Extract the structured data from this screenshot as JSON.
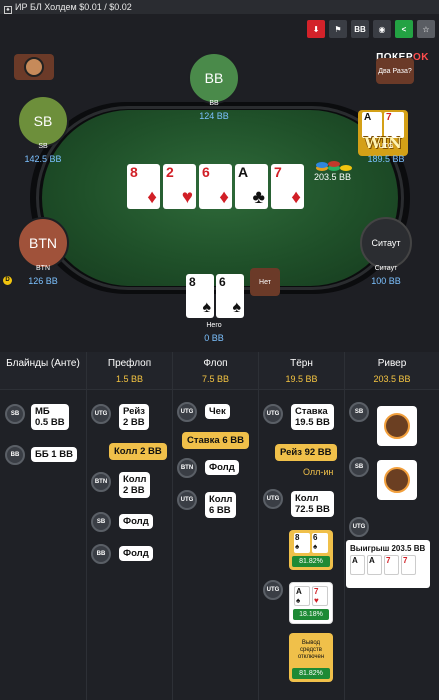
{
  "window": {
    "title": "ИР БЛ Холдем $0.01 / $0.02"
  },
  "toolbar": {
    "buttons": [
      {
        "icon": "download-icon",
        "glyph": "⬇",
        "style": "red"
      },
      {
        "icon": "flag-icon",
        "glyph": "⚑",
        "style": "dark"
      },
      {
        "icon": "bb-toggle-icon",
        "glyph": "BB",
        "style": "dark"
      },
      {
        "icon": "spy-icon",
        "glyph": "◉",
        "style": "dark"
      },
      {
        "icon": "share-icon",
        "glyph": "<",
        "style": "green"
      },
      {
        "icon": "star-icon",
        "glyph": "☆",
        "style": "grey"
      }
    ]
  },
  "brand": {
    "prefix": "ПОКЕР",
    "accent": "OK"
  },
  "table": {
    "board": [
      {
        "rank": "8",
        "suit": "♦",
        "color": "red"
      },
      {
        "rank": "2",
        "suit": "♥",
        "color": "red"
      },
      {
        "rank": "6",
        "suit": "♦",
        "color": "red"
      },
      {
        "rank": "A",
        "suit": "♣",
        "color": "black"
      },
      {
        "rank": "7",
        "suit": "♦",
        "color": "red"
      }
    ],
    "pot": "203.5 BB",
    "seats": {
      "bb": {
        "label": "BB",
        "name": "BB",
        "stack": "124 BB",
        "color": "#4a8a4a"
      },
      "sb": {
        "label": "SB",
        "name": "SB",
        "stack": "142.5 BB",
        "color": "#6d8f3b"
      },
      "utg": {
        "name": "UTG",
        "stack": "189.5 BB"
      },
      "btn": {
        "label": "BTN",
        "name": "BTN",
        "stack": "126 BB",
        "color": "#a0523a"
      },
      "sitout": {
        "label": "Ситаут",
        "name": "Ситаут",
        "stack": "100 BB",
        "color": "#2b2d31"
      },
      "hero": {
        "name": "Него",
        "stack": "0 BB",
        "cards": [
          {
            "rank": "8",
            "suit": "♠"
          },
          {
            "rank": "6",
            "suit": "♠"
          }
        ]
      }
    },
    "bubbles": {
      "utg": "Два Раза?",
      "hero": "Нет"
    },
    "winner_badge": {
      "text": "WIN",
      "cards": [
        {
          "rank": "A",
          "color": "black"
        },
        {
          "rank": "7",
          "color": "red"
        }
      ]
    },
    "dealer": "D"
  },
  "history": {
    "columns": [
      {
        "title": "Блайнды (Анте)",
        "pot": ""
      },
      {
        "title": "Префлоп",
        "pot": "1.5 BB"
      },
      {
        "title": "Флоп",
        "pot": "7.5 BB"
      },
      {
        "title": "Тёрн",
        "pot": "19.5 BB"
      },
      {
        "title": "Ривер",
        "pot": "203.5 BB"
      }
    ],
    "blinds": [
      {
        "pos": "SB",
        "text": "МБ\n0.5 BB"
      },
      {
        "pos": "BB",
        "text": "ББ 1 BB"
      }
    ],
    "preflop": [
      {
        "pos": "UTG",
        "text": "Рейз\n2 BB"
      },
      {
        "text": "Колл 2 BB"
      },
      {
        "pos": "BTN",
        "text": "Колл\n2 BB"
      },
      {
        "pos": "SB",
        "text": "Фолд"
      },
      {
        "pos": "BB",
        "text": "Фолд"
      }
    ],
    "flop": [
      {
        "pos": "UTG",
        "text": "Чек"
      },
      {
        "text": "Ставка 6 BB"
      },
      {
        "pos": "BTN",
        "text": "Фолд"
      },
      {
        "pos": "UTG",
        "text": "Колл\n6 BB"
      }
    ],
    "turn": [
      {
        "pos": "UTG",
        "text": "Ставка\n19.5 BB"
      },
      {
        "text": "Рейз 92 BB"
      },
      {
        "allin": "Олл-ин"
      },
      {
        "pos": "UTG",
        "text": "Колл\n72.5 BB"
      },
      {
        "equity": {
          "cards": [
            {
              "rank": "8",
              "suit": "♠"
            },
            {
              "rank": "6",
              "suit": "♠"
            }
          ],
          "pct": "81.82%"
        }
      },
      {
        "pos": "UTG",
        "equity": {
          "cards": [
            {
              "rank": "A",
              "suit": "♠"
            },
            {
              "rank": "7",
              "suit": "♥"
            }
          ],
          "pct": "18.18%"
        }
      },
      {
        "equity": {
          "text": "Вывод средств отключен",
          "pct": "81.82%"
        }
      }
    ],
    "river": [
      {
        "pos": "SB",
        "emoji": "face"
      },
      {
        "pos": "SB",
        "emoji": "face"
      },
      {
        "pos": "UTG",
        "win": {
          "label": "Выигрыш 203.5 BB",
          "cards": [
            {
              "rank": "A",
              "color": "black"
            },
            {
              "rank": "A",
              "color": "black"
            },
            {
              "rank": "7",
              "color": "red"
            },
            {
              "rank": "7",
              "color": "red"
            }
          ]
        }
      }
    ]
  }
}
